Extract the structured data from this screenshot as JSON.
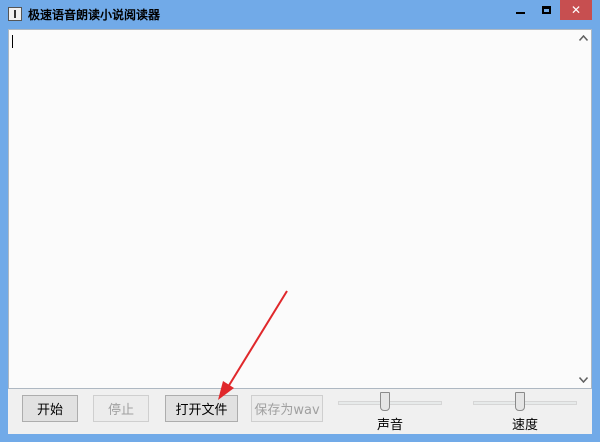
{
  "window": {
    "title": "极速语音朗读小说阅读器",
    "controls": {
      "minimize": "minimize",
      "maximize": "maximize",
      "close": "✕"
    }
  },
  "editor": {
    "value": ""
  },
  "toolbar": {
    "start_label": "开始",
    "stop_label": "停止",
    "open_label": "打开文件",
    "save_label": "保存为wav"
  },
  "sliders": {
    "volume": {
      "label": "声音",
      "level_percent": 45
    },
    "speed": {
      "label": "速度",
      "level_percent": 45
    }
  },
  "colors": {
    "titlebar": "#71aae8",
    "close": "#c74f50",
    "annotation_arrow": "#e0282b"
  },
  "icons": {
    "app": "app-icon",
    "scroll_up": "chevron-up-icon",
    "scroll_down": "chevron-down-icon"
  }
}
